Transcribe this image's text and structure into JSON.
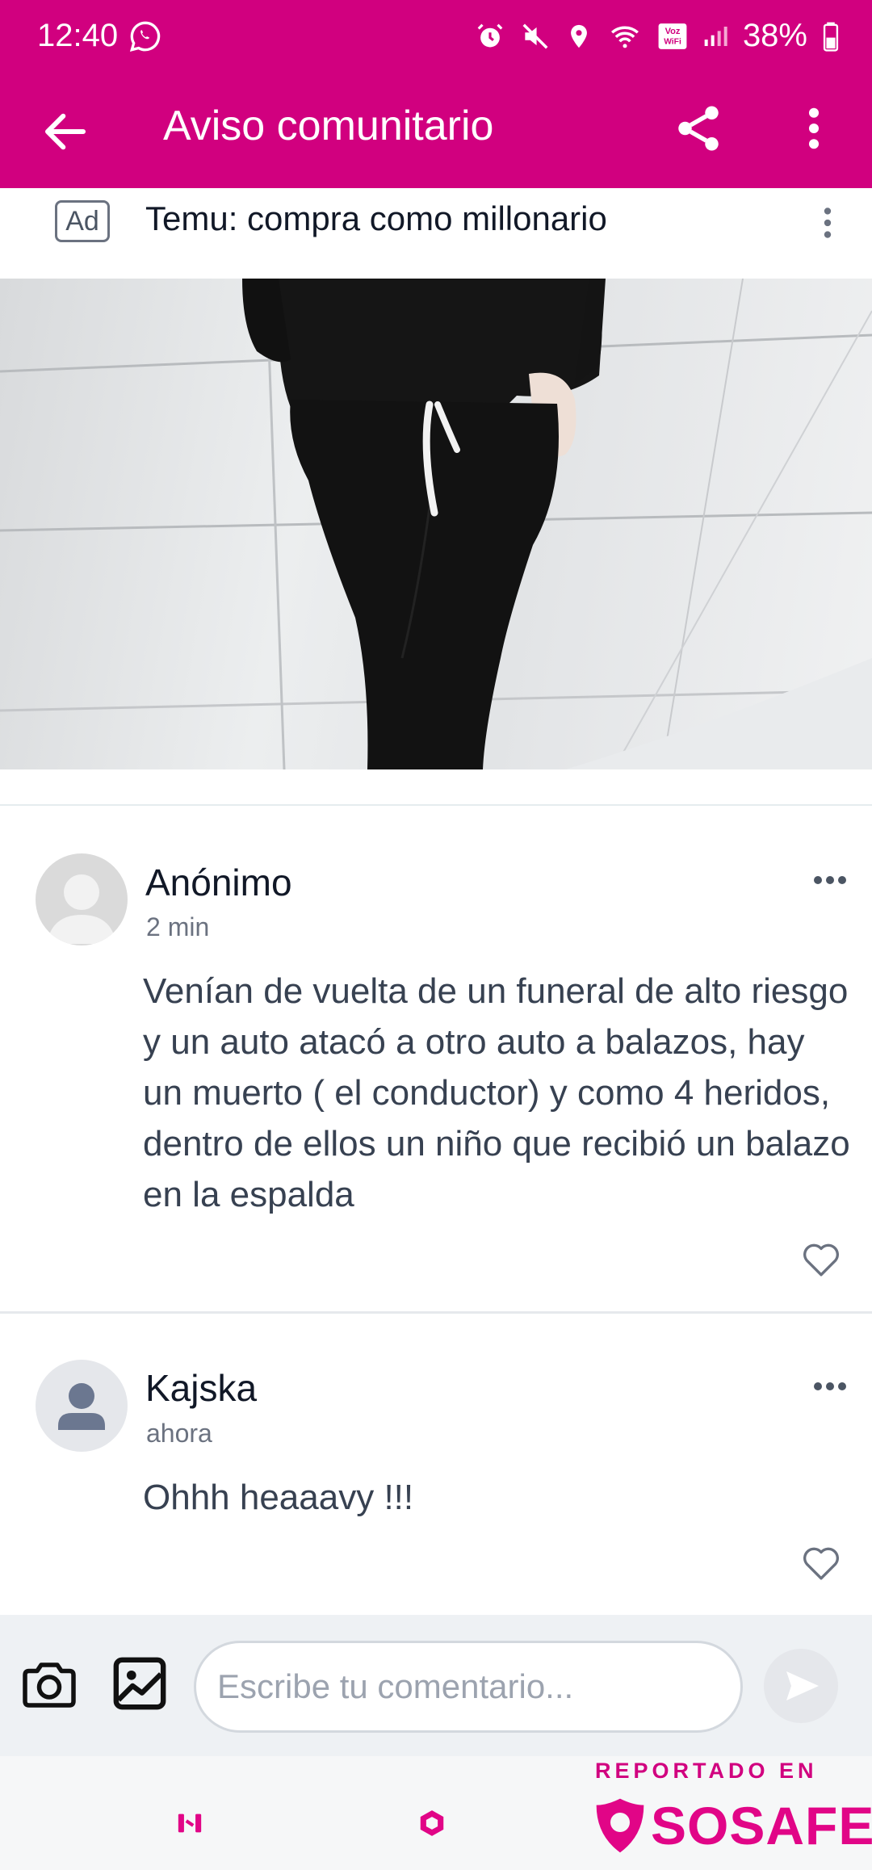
{
  "status_bar": {
    "time": "12:40",
    "battery": "38%",
    "icons": [
      "whatsapp-icon",
      "alarm-icon",
      "mute-icon",
      "location-icon",
      "wifi-icon",
      "voz-wifi-icon",
      "signal-icon",
      "battery-icon"
    ],
    "volte_label": "Voz WiFi"
  },
  "app_bar": {
    "title": "Aviso comunitario"
  },
  "ad": {
    "badge": "Ad",
    "title": "Temu: compra como millonario"
  },
  "comments": [
    {
      "author": "Anónimo",
      "time": "2 min",
      "text": "Venían de vuelta de un funeral de alto riesgo y un auto atacó a otro auto a balazos, hay un muerto ( el conductor) y como 4 heridos, dentro de ellos un niño que recibió un balazo en la espalda"
    },
    {
      "author": "Kajska",
      "time": "ahora",
      "text": "Ohhh heaaavy !!!"
    }
  ],
  "composer": {
    "placeholder": "Escribe tu comentario..."
  },
  "footer": {
    "reported_label": "REPORTADO EN",
    "brand": "SOSAFE"
  },
  "colors": {
    "primary": "#d1007f",
    "brand": "#e10587",
    "text": "#374151"
  }
}
